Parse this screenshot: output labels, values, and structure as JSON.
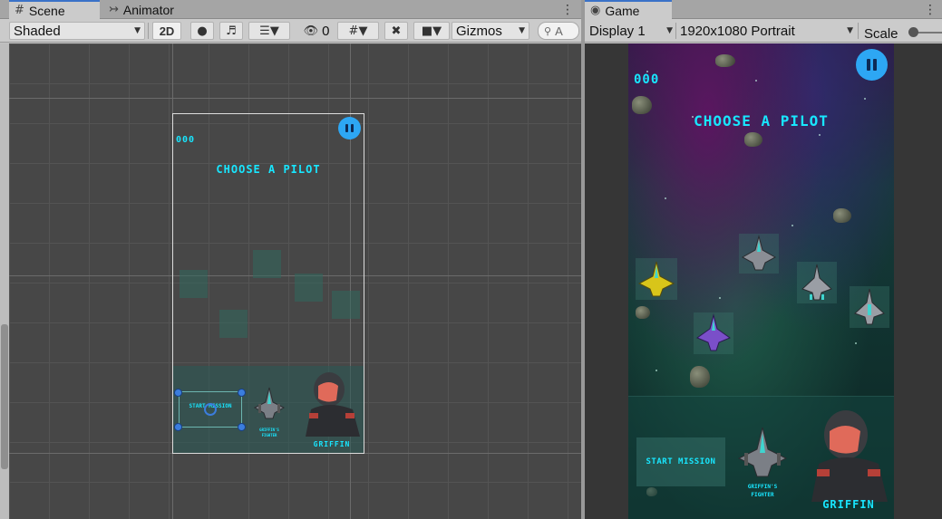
{
  "scene_tabs": [
    {
      "label": "Scene",
      "icon": "grid-icon"
    },
    {
      "label": "Animator",
      "icon": "animator-icon"
    }
  ],
  "scene_toolbar": {
    "shading_mode": "Shaded",
    "mode_2d": "2D",
    "hidden_count": "0",
    "gizmos_label": "Gizmos",
    "search_placeholder": "A"
  },
  "game_tab": {
    "label": "Game",
    "icon": "gamepad-icon"
  },
  "game_toolbar": {
    "display": "Display 1",
    "resolution": "1920x1080 Portrait",
    "scale_label": "Scale"
  },
  "ui": {
    "score": "000",
    "title": "CHOOSE A PILOT",
    "start_button": "START MISSION",
    "fighter_caption_1": "GRIFFIN'S",
    "fighter_caption_2": "FIGHTER",
    "pilot_name": "GRIFFIN"
  },
  "colors": {
    "accent_tab": "#3a72c8",
    "neon_text": "#18e6ff",
    "pause_button": "#2da7f4",
    "handle": "#3b7ddd"
  }
}
